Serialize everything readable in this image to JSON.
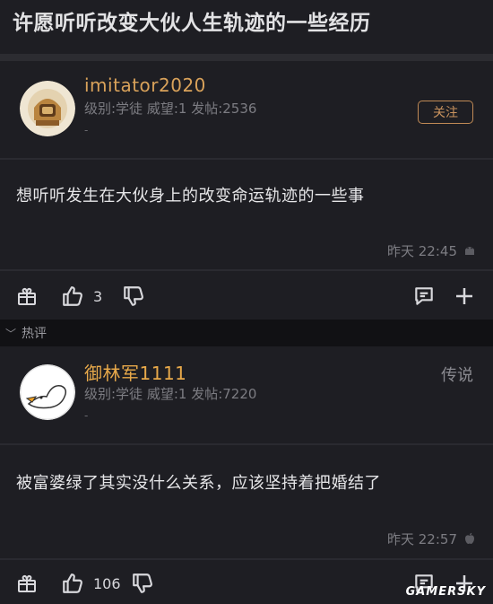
{
  "thread": {
    "title": "许愿听听改变大伙人生轨迹的一些经历"
  },
  "original_post": {
    "username": "imitator2020",
    "meta": "级别:学徒 威望:1 发帖:2536",
    "dash": "-",
    "follow_label": "关注",
    "content": "想听听发生在大伙身上的改变命运轨迹的一些事",
    "time": "昨天 22:45",
    "os_icon": "android-icon",
    "likes": "3"
  },
  "hot_section": {
    "label": "热评"
  },
  "hot_comment": {
    "username": "御林军1111",
    "meta": "级别:学徒 威望:1 发帖:7220",
    "dash": "-",
    "rank": "传说",
    "content": "被富婆绿了其实没什么关系，应该坚持着把婚结了",
    "time": "昨天 22:57",
    "os_icon": "apple-icon",
    "likes": "106"
  },
  "watermark": "GAMERSKY",
  "colors": {
    "background": "#1e1e23",
    "follow_accent": "#c9935e",
    "username_comment": "#e8a94a"
  }
}
